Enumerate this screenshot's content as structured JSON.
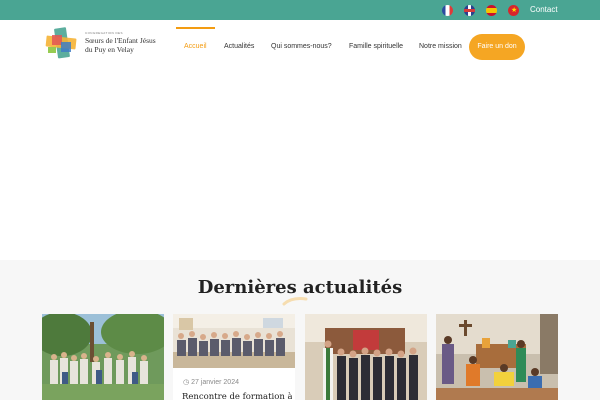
{
  "topbar": {
    "flags": [
      "flag-france-icon",
      "flag-uk-icon",
      "flag-spain-icon",
      "flag-vietnam-icon"
    ],
    "contact_label": "Contact",
    "bg_color": "#4aa593"
  },
  "brand": {
    "small_caption": "CONGREGATION DES",
    "name_line1": "Sœurs de l'Enfant Jésus",
    "name_line2": "du Puy en Velay"
  },
  "nav": {
    "items": [
      "Accueil",
      "Actualités",
      "Qui sommes-nous?",
      "Famille spirituelle",
      "Notre mission"
    ],
    "active": "Accueil",
    "donate_label": "Faire un don",
    "accent_color": "#f39c12"
  },
  "news": {
    "heading": "Dernières actualités",
    "cards": [
      {
        "image": "group-photo-garden"
      },
      {
        "image": "group-photo-meeting-room",
        "date": "27 janvier 2024",
        "headline": "Rencontre de formation à"
      },
      {
        "image": "group-photo-church"
      },
      {
        "image": "group-photo-indoor-celebration"
      }
    ]
  }
}
